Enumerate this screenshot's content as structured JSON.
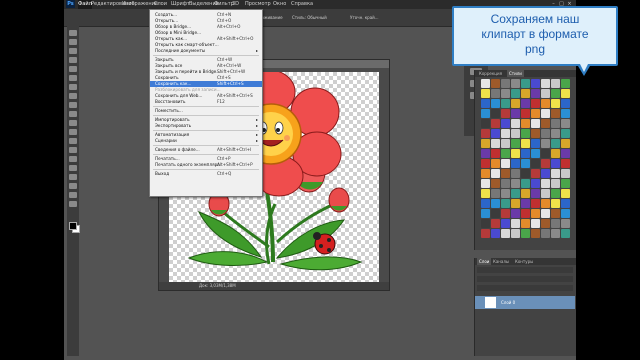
{
  "app": {
    "logo": "Ps",
    "menus": [
      "Файл",
      "Редактирование",
      "Изображение",
      "Слои",
      "Шрифт",
      "Выделение",
      "Фильтр",
      "3D",
      "Просмотр",
      "Окно",
      "Справка"
    ],
    "active_menu": "Файл",
    "icons": {
      "minimize": "minimize-icon",
      "maximize": "maximize-icon",
      "close": "close-icon"
    }
  },
  "options_bar": {
    "feather_value": "32",
    "antialias_label": "Сглаживание",
    "style_label": "Стиль: Обычный",
    "edge_label": "Уточн. край..."
  },
  "document": {
    "tab_title": "Слой 0, RGB/8) *",
    "status": "Док: 3,03М/1,38М"
  },
  "file_menu": {
    "items": [
      {
        "label": "Создать...",
        "shortcut": "Ctrl+N"
      },
      {
        "label": "Открыть...",
        "shortcut": "Ctrl+O"
      },
      {
        "label": "Обзор в Bridge...",
        "shortcut": "Alt+Ctrl+O"
      },
      {
        "label": "Обзор в Mini Bridge...",
        "shortcut": ""
      },
      {
        "label": "Открыть как...",
        "shortcut": "Alt+Shift+Ctrl+O"
      },
      {
        "label": "Открыть как смарт-объект...",
        "shortcut": ""
      },
      {
        "label": "Последние документы",
        "shortcut": "",
        "submenu": true
      },
      {
        "sep": true
      },
      {
        "label": "Закрыть",
        "shortcut": "Ctrl+W"
      },
      {
        "label": "Закрыть все",
        "shortcut": "Alt+Ctrl+W"
      },
      {
        "label": "Закрыть и перейти в Bridge...",
        "shortcut": "Shift+Ctrl+W"
      },
      {
        "label": "Сохранить",
        "shortcut": "Ctrl+S"
      },
      {
        "label": "Сохранить как...",
        "shortcut": "Shift+Ctrl+S",
        "highlight": true
      },
      {
        "label": "Разблокировать для записи...",
        "shortcut": "",
        "disabled": true
      },
      {
        "label": "Сохранить для Web...",
        "shortcut": "Alt+Shift+Ctrl+S"
      },
      {
        "label": "Восстановить",
        "shortcut": "F12"
      },
      {
        "sep": true
      },
      {
        "label": "Поместить...",
        "shortcut": ""
      },
      {
        "sep": true
      },
      {
        "label": "Импортировать",
        "shortcut": "",
        "submenu": true
      },
      {
        "label": "Экспортировать",
        "shortcut": "",
        "submenu": true
      },
      {
        "sep": true
      },
      {
        "label": "Автоматизация",
        "shortcut": "",
        "submenu": true
      },
      {
        "label": "Сценарии",
        "shortcut": "",
        "submenu": true
      },
      {
        "sep": true
      },
      {
        "label": "Сведения о файле...",
        "shortcut": "Alt+Shift+Ctrl+I"
      },
      {
        "sep": true
      },
      {
        "label": "Печатать...",
        "shortcut": "Ctrl+P"
      },
      {
        "label": "Печатать одного экземпляра",
        "shortcut": "Alt+Shift+Ctrl+P"
      },
      {
        "sep": true
      },
      {
        "label": "Выход",
        "shortcut": "Ctrl+Q"
      }
    ]
  },
  "styles_panel": {
    "tabs": [
      "Коррекция",
      "Стили"
    ],
    "active_tab": "Стили",
    "swatch_colors": [
      "#e6e6e6",
      "#3b3b3b",
      "#c03030",
      "#2c66c9",
      "#d8a72a",
      "#4aa64a",
      "#8a8a8a",
      "#d9d9d9",
      "#9e5a2a",
      "#b43a3a",
      "#e38b2b",
      "#2a8fd4",
      "#6a3aa8",
      "#f0e24a",
      "#3a9a8a",
      "#c9c9c9",
      "#777",
      "#4a4ad0"
    ]
  },
  "layers_panel": {
    "tabs": [
      "Слои",
      "Каналы",
      "Контуры"
    ],
    "active_tab": "Слои",
    "layer_name": "Слой 0"
  },
  "callout": {
    "line1": "Сохраняем наш",
    "line2": "клипарт в формате",
    "line3": "png"
  }
}
